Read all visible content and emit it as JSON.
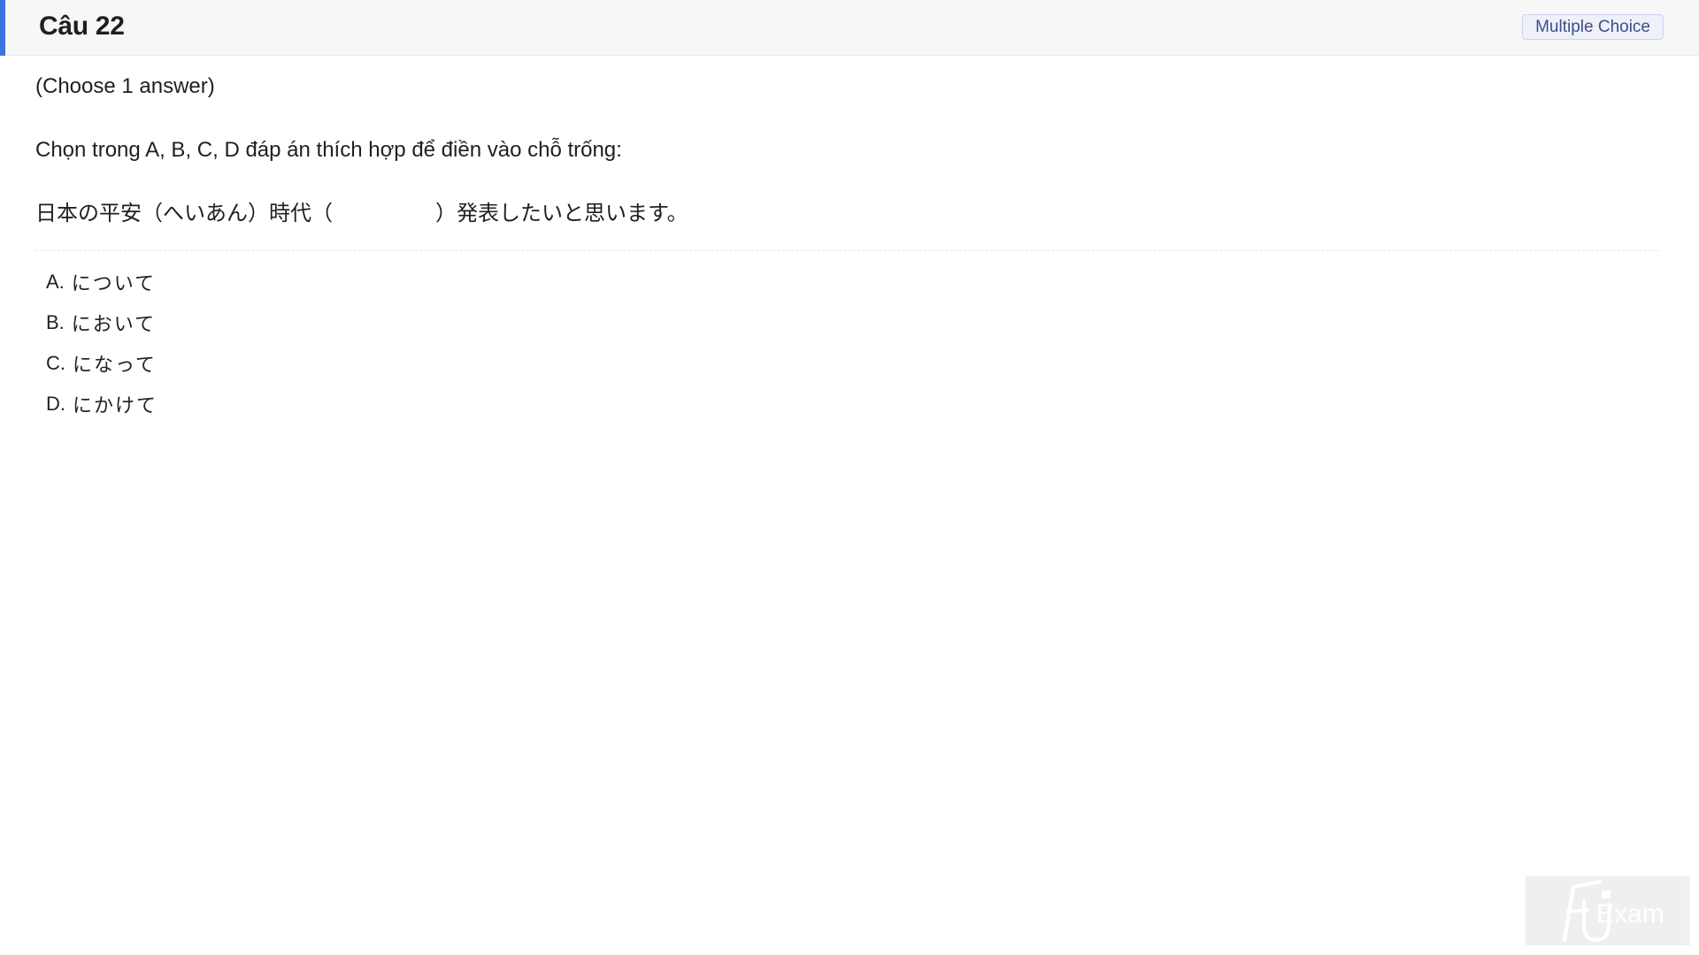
{
  "header": {
    "title": "Câu 22",
    "type_badge": "Multiple Choice"
  },
  "question": {
    "hint": "(Choose 1 answer)",
    "instruction": "Chọn trong A, B, C, D đáp án thích hợp để điền vào chỗ trống:",
    "sentence_before": "日本の平安（へいあん）時代（",
    "sentence_after": "）発表したいと思います。"
  },
  "options": [
    {
      "letter": "A.",
      "text": "について"
    },
    {
      "letter": "B.",
      "text": "において"
    },
    {
      "letter": "C.",
      "text": "になって"
    },
    {
      "letter": "D.",
      "text": "にかけて"
    }
  ],
  "watermark": {
    "logo_letters": "FU",
    "text": "Exam"
  },
  "colors": {
    "accent": "#3b73e0",
    "badge_bg": "#eef1fa",
    "badge_text": "#3c4f86",
    "header_bg": "#f7f7f7"
  }
}
